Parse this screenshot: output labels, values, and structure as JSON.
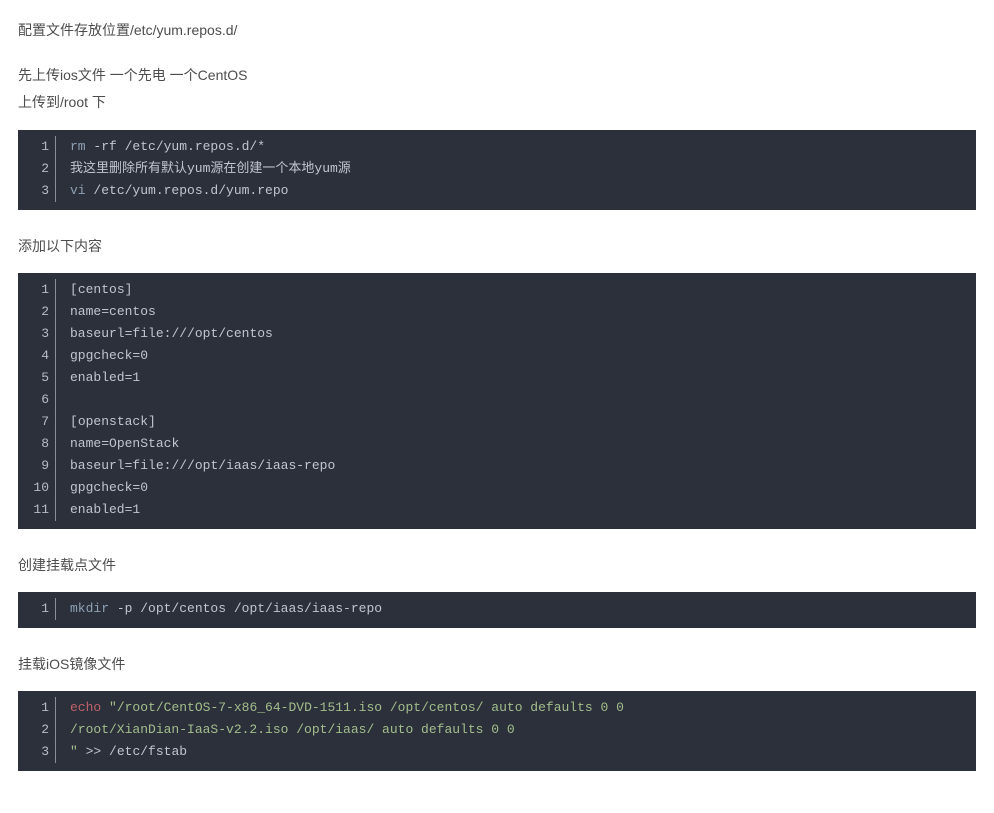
{
  "paragraphs": {
    "p1": "配置文件存放位置/etc/yum.repos.d/",
    "p2": "先上传ios文件 一个先电 一个CentOS",
    "p3": "上传到/root 下",
    "p4": "添加以下内容",
    "p5": "创建挂载点文件",
    "p6": "挂载iOS镜像文件"
  },
  "code1": {
    "l1": {
      "rm": "rm",
      "opt": " -rf /etc/yum.repos.d/*"
    },
    "l2": {
      "txt": "我这里删除所有默认yum源在创建一个本地yum源"
    },
    "l3": {
      "vi": "vi",
      "path": " /etc/yum.repos.d/yum.repo"
    }
  },
  "code2": {
    "l1": {
      "lb": "[",
      "name": "centos",
      "rb": "]"
    },
    "l2": {
      "key": "name",
      "eq": "=",
      "val": "centos"
    },
    "l3": {
      "key": "baseurl",
      "eq": "=",
      "proto": "file:",
      "path": "///opt/centos"
    },
    "l4": {
      "key": "gpgcheck",
      "eq": "=",
      "val": "0"
    },
    "l5": {
      "key": "enabled",
      "eq": "=",
      "val": "1"
    },
    "l6": {
      "txt": ""
    },
    "l7": {
      "lb": "[",
      "name": "openstack",
      "rb": "]"
    },
    "l8": {
      "key": "name",
      "eq": "=",
      "val": "OpenStack"
    },
    "l9": {
      "key": "baseurl",
      "eq": "=",
      "proto": "file:",
      "path": "///opt/iaas/iaas-repo"
    },
    "l10": {
      "key": "gpgcheck",
      "eq": "=",
      "val": "0"
    },
    "l11": {
      "key": "enabled",
      "eq": "=",
      "val": "1"
    }
  },
  "code3": {
    "l1": {
      "mkdir": "mkdir",
      "opt": " -p /opt/centos /opt/iaas/iaas-repo"
    }
  },
  "code4": {
    "l1": {
      "echo": "echo",
      "sp": " ",
      "str": "\"/root/CentOS-7-x86_64-DVD-1511.iso /opt/centos/ auto defaults 0 0"
    },
    "l2": {
      "str": "/root/XianDian-IaaS-v2.2.iso /opt/iaas/ auto defaults 0 0"
    },
    "l3": {
      "str": "\"",
      "sp": " ",
      "redir": ">>",
      "sp2": " ",
      "path": "/etc/fstab"
    }
  },
  "linenos": {
    "n1": "1",
    "n2": "2",
    "n3": "3",
    "n4": "4",
    "n5": "5",
    "n6": "6",
    "n7": "7",
    "n8": "8",
    "n9": "9",
    "n10": "10",
    "n11": "11"
  }
}
